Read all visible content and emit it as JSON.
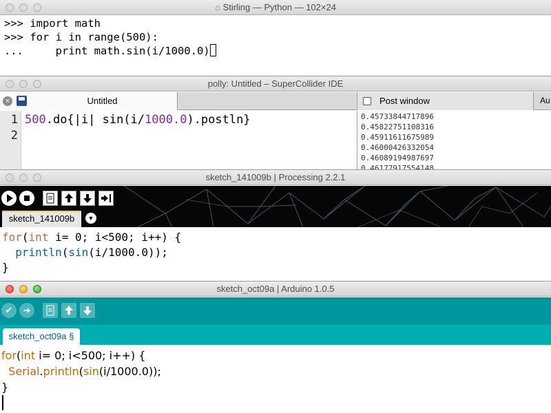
{
  "terminal": {
    "title": "Stirling — Python — 102×24",
    "lines": [
      ">>> import math",
      ">>> for i in range(500):",
      "...     print math.sin(i/1000.0)"
    ]
  },
  "supercollider": {
    "title": "polly: Untitled – SuperCollider IDE",
    "doc_tab": "Untitled",
    "post_tab": "Post window",
    "truncated_tab": "Au",
    "line_numbers": [
      "1",
      "2"
    ],
    "code": {
      "num1": "500",
      "mid": ".do{|i| sin(i/",
      "num2": "1000.0",
      "end": ").postln}"
    },
    "post_output": [
      "0.45733844717896",
      "0.45822751108316",
      "0.45911611675989",
      "0.46000426332054",
      "0.46089194987697",
      "0.46177917554148"
    ]
  },
  "processing": {
    "title": "sketch_141009b | Processing 2.2.1",
    "tab": "sketch_141009b",
    "code": {
      "l1_kw1": "for",
      "l1_a": "(",
      "l1_kw2": "int",
      "l1_b": " i= 0; i<500; i++) {",
      "l2_indent": "  ",
      "l2_fn1": "println",
      "l2_a": "(",
      "l2_fn2": "sin",
      "l2_b": "(i/1000.0));",
      "l3": "}"
    }
  },
  "arduino": {
    "title": "sketch_oct09a | Arduino 1.0.5",
    "tab": "sketch_oct09a §",
    "code": {
      "l1_kw1": "for",
      "l1_a": "(",
      "l1_kw2": "int",
      "l1_b": " i= 0; i<500; i++) {",
      "l2_indent": "  ",
      "l2_obj": "Serial",
      "l2_dot": ".",
      "l2_fn1": "println",
      "l2_a": "(",
      "l2_fn2": "sin",
      "l2_b": "(i/1000.0));",
      "l3": "}"
    }
  },
  "colors": {
    "arduino_teal": "#00979c",
    "processing_keyword": "#cc6633",
    "processing_function": "#006699",
    "sc_number": "#8a1fb4",
    "arduino_keyword": "#cc6600"
  }
}
